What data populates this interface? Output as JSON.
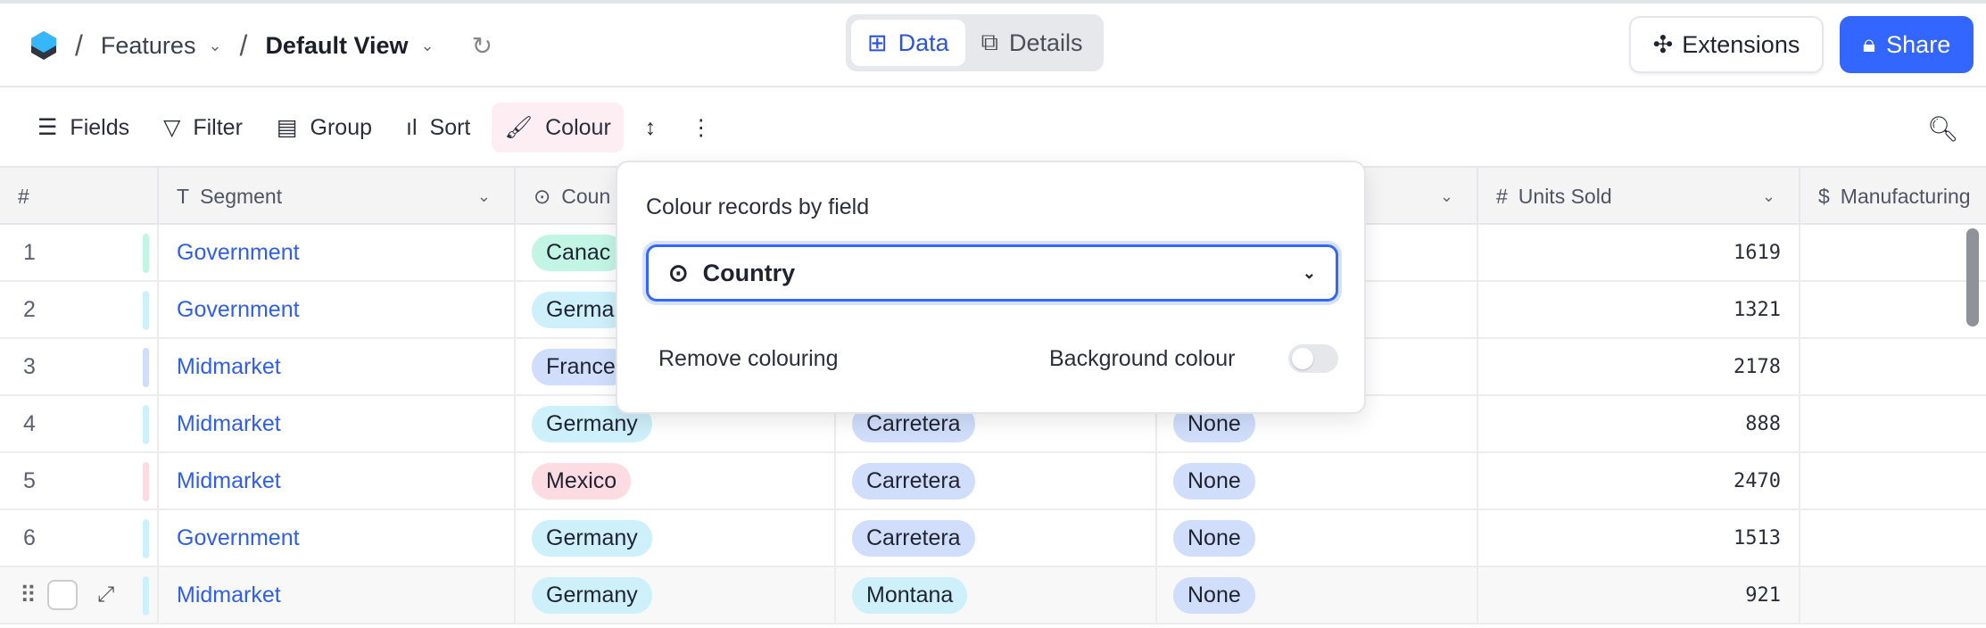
{
  "header": {
    "breadcrumb": [
      "Features",
      "Default View"
    ],
    "tabs": [
      {
        "label": "Data",
        "active": true
      },
      {
        "label": "Details",
        "active": false
      }
    ],
    "extensions_label": "Extensions",
    "share_label": "Share"
  },
  "toolbar": {
    "fields": "Fields",
    "filter": "Filter",
    "group": "Group",
    "sort": "Sort",
    "colour": "Colour"
  },
  "columns": {
    "index": "#",
    "segment": "Segment",
    "country": "Coun",
    "units": "Units Sold",
    "manufacturing": "Manufacturing"
  },
  "colors": {
    "accent": "#3366ff",
    "link": "#2f5fe8",
    "Canada": "#c3f5e5",
    "Germany": "#cdf0fb",
    "France": "#d0defc",
    "Mexico": "#fcdbe3",
    "Carretera": "#d0defc",
    "Montana": "#cdf0fb",
    "None": "#d0defc"
  },
  "rows": [
    {
      "n": "1",
      "segment": "Government",
      "country": "Canac",
      "product": "",
      "discount": "",
      "units": "1619"
    },
    {
      "n": "2",
      "segment": "Government",
      "country": "Germa",
      "product": "",
      "discount": "",
      "units": "1321"
    },
    {
      "n": "3",
      "segment": "Midmarket",
      "country": "France",
      "product": "",
      "discount": "",
      "units": "2178"
    },
    {
      "n": "4",
      "segment": "Midmarket",
      "country": "Germany",
      "product": "Carretera",
      "discount": "None",
      "units": "888"
    },
    {
      "n": "5",
      "segment": "Midmarket",
      "country": "Mexico",
      "product": "Carretera",
      "discount": "None",
      "units": "2470"
    },
    {
      "n": "6",
      "segment": "Government",
      "country": "Germany",
      "product": "Carretera",
      "discount": "None",
      "units": "1513"
    },
    {
      "n": "",
      "segment": "Midmarket",
      "country": "Germany",
      "product": "Montana",
      "discount": "None",
      "units": "921"
    }
  ],
  "popup": {
    "title": "Colour records by field",
    "selected_field": "Country",
    "remove_label": "Remove colouring",
    "background_label": "Background colour",
    "background_on": false
  }
}
